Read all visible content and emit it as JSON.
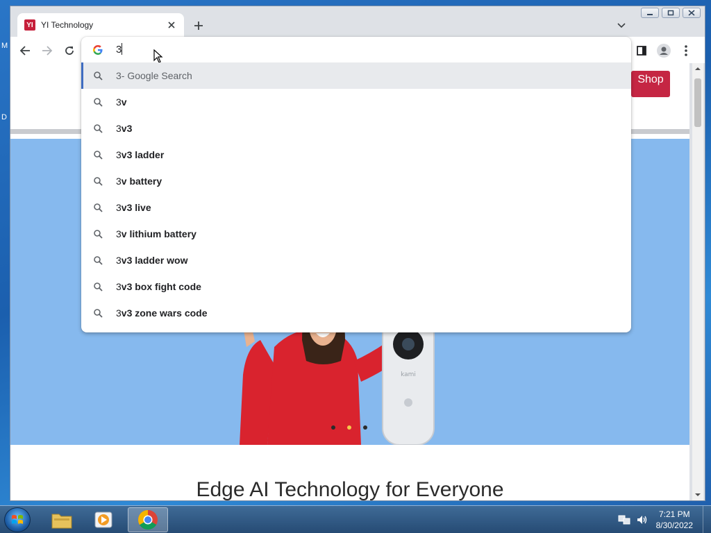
{
  "desktop": {
    "label_m": "M",
    "label_d": "D"
  },
  "tab": {
    "title": "YI Technology",
    "favicon_text": "YI"
  },
  "omnibox": {
    "value": "3",
    "selected_suggestion": {
      "typed": "3",
      "label": " - Google Search"
    },
    "suggestions": [
      {
        "typed": "3",
        "rest": "v"
      },
      {
        "typed": "3",
        "rest": "v3"
      },
      {
        "typed": "3",
        "rest": "v3 ladder"
      },
      {
        "typed": "3",
        "rest": "v battery"
      },
      {
        "typed": "3",
        "rest": "v3 live"
      },
      {
        "typed": "3",
        "rest": "v lithium battery"
      },
      {
        "typed": "3",
        "rest": "v3 ladder wow"
      },
      {
        "typed": "3",
        "rest": "v3 box fight code"
      },
      {
        "typed": "3",
        "rest": "v3 zone wars code"
      }
    ]
  },
  "page": {
    "shop_label": "Shop",
    "headline": "Edge AI Technology for Everyone",
    "doorbell_brand": "kami",
    "carousel": {
      "count": 3,
      "active_index": 1
    }
  },
  "taskbar": {
    "time": "7:21 PM",
    "date": "8/30/2022",
    "apps": [
      "file-explorer",
      "media-player",
      "chrome"
    ]
  },
  "colors": {
    "brand_red": "#c52643",
    "hero_bg": "#86b9ee",
    "accent_blue": "#3f6cc1"
  }
}
